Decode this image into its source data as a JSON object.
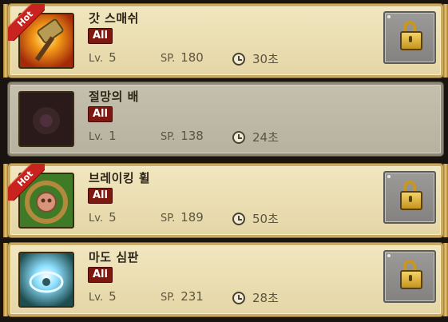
{
  "skills": [
    {
      "name": "갓 스매쉬",
      "badge": "All",
      "lv_key": "Lv.",
      "lv": "5",
      "sp_key": "SP.",
      "sp": "180",
      "time": "30초",
      "hot": true,
      "hot_label": "Hot",
      "locked_row": false
    },
    {
      "name": "절망의 배",
      "badge": "All",
      "lv_key": "Lv.",
      "lv": "1",
      "sp_key": "SP.",
      "sp": "138",
      "time": "24초",
      "hot": false,
      "locked_row": true
    },
    {
      "name": "브레이킹 휠",
      "badge": "All",
      "lv_key": "Lv.",
      "lv": "5",
      "sp_key": "SP.",
      "sp": "189",
      "time": "50초",
      "hot": true,
      "hot_label": "Hot",
      "locked_row": false
    },
    {
      "name": "마도 심판",
      "badge": "All",
      "lv_key": "Lv.",
      "lv": "5",
      "sp_key": "SP.",
      "sp": "231",
      "time": "28초",
      "hot": false,
      "locked_row": false
    }
  ],
  "colors": {
    "hot_ribbon": "#c8231e",
    "badge_bg": "#7d1810",
    "row_gold": "#e4d6a6",
    "row_grey": "#b7b1a0"
  },
  "icons": [
    "hammer-icon",
    "dark-creature-icon",
    "wheel-icon",
    "magic-seal-icon",
    "clock-icon",
    "padlock-icon"
  ]
}
